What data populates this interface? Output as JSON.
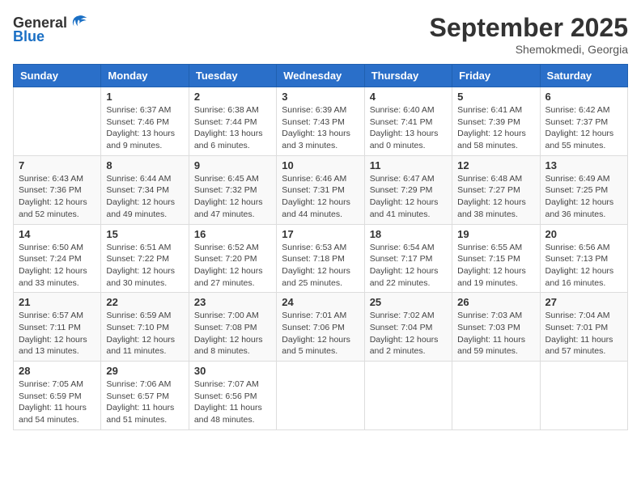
{
  "header": {
    "logo_general": "General",
    "logo_blue": "Blue",
    "month_title": "September 2025",
    "location": "Shemokmedi, Georgia"
  },
  "weekdays": [
    "Sunday",
    "Monday",
    "Tuesday",
    "Wednesday",
    "Thursday",
    "Friday",
    "Saturday"
  ],
  "weeks": [
    [
      {
        "day": "",
        "sunrise": "",
        "sunset": "",
        "daylight": ""
      },
      {
        "day": "1",
        "sunrise": "Sunrise: 6:37 AM",
        "sunset": "Sunset: 7:46 PM",
        "daylight": "Daylight: 13 hours and 9 minutes."
      },
      {
        "day": "2",
        "sunrise": "Sunrise: 6:38 AM",
        "sunset": "Sunset: 7:44 PM",
        "daylight": "Daylight: 13 hours and 6 minutes."
      },
      {
        "day": "3",
        "sunrise": "Sunrise: 6:39 AM",
        "sunset": "Sunset: 7:43 PM",
        "daylight": "Daylight: 13 hours and 3 minutes."
      },
      {
        "day": "4",
        "sunrise": "Sunrise: 6:40 AM",
        "sunset": "Sunset: 7:41 PM",
        "daylight": "Daylight: 13 hours and 0 minutes."
      },
      {
        "day": "5",
        "sunrise": "Sunrise: 6:41 AM",
        "sunset": "Sunset: 7:39 PM",
        "daylight": "Daylight: 12 hours and 58 minutes."
      },
      {
        "day": "6",
        "sunrise": "Sunrise: 6:42 AM",
        "sunset": "Sunset: 7:37 PM",
        "daylight": "Daylight: 12 hours and 55 minutes."
      }
    ],
    [
      {
        "day": "7",
        "sunrise": "Sunrise: 6:43 AM",
        "sunset": "Sunset: 7:36 PM",
        "daylight": "Daylight: 12 hours and 52 minutes."
      },
      {
        "day": "8",
        "sunrise": "Sunrise: 6:44 AM",
        "sunset": "Sunset: 7:34 PM",
        "daylight": "Daylight: 12 hours and 49 minutes."
      },
      {
        "day": "9",
        "sunrise": "Sunrise: 6:45 AM",
        "sunset": "Sunset: 7:32 PM",
        "daylight": "Daylight: 12 hours and 47 minutes."
      },
      {
        "day": "10",
        "sunrise": "Sunrise: 6:46 AM",
        "sunset": "Sunset: 7:31 PM",
        "daylight": "Daylight: 12 hours and 44 minutes."
      },
      {
        "day": "11",
        "sunrise": "Sunrise: 6:47 AM",
        "sunset": "Sunset: 7:29 PM",
        "daylight": "Daylight: 12 hours and 41 minutes."
      },
      {
        "day": "12",
        "sunrise": "Sunrise: 6:48 AM",
        "sunset": "Sunset: 7:27 PM",
        "daylight": "Daylight: 12 hours and 38 minutes."
      },
      {
        "day": "13",
        "sunrise": "Sunrise: 6:49 AM",
        "sunset": "Sunset: 7:25 PM",
        "daylight": "Daylight: 12 hours and 36 minutes."
      }
    ],
    [
      {
        "day": "14",
        "sunrise": "Sunrise: 6:50 AM",
        "sunset": "Sunset: 7:24 PM",
        "daylight": "Daylight: 12 hours and 33 minutes."
      },
      {
        "day": "15",
        "sunrise": "Sunrise: 6:51 AM",
        "sunset": "Sunset: 7:22 PM",
        "daylight": "Daylight: 12 hours and 30 minutes."
      },
      {
        "day": "16",
        "sunrise": "Sunrise: 6:52 AM",
        "sunset": "Sunset: 7:20 PM",
        "daylight": "Daylight: 12 hours and 27 minutes."
      },
      {
        "day": "17",
        "sunrise": "Sunrise: 6:53 AM",
        "sunset": "Sunset: 7:18 PM",
        "daylight": "Daylight: 12 hours and 25 minutes."
      },
      {
        "day": "18",
        "sunrise": "Sunrise: 6:54 AM",
        "sunset": "Sunset: 7:17 PM",
        "daylight": "Daylight: 12 hours and 22 minutes."
      },
      {
        "day": "19",
        "sunrise": "Sunrise: 6:55 AM",
        "sunset": "Sunset: 7:15 PM",
        "daylight": "Daylight: 12 hours and 19 minutes."
      },
      {
        "day": "20",
        "sunrise": "Sunrise: 6:56 AM",
        "sunset": "Sunset: 7:13 PM",
        "daylight": "Daylight: 12 hours and 16 minutes."
      }
    ],
    [
      {
        "day": "21",
        "sunrise": "Sunrise: 6:57 AM",
        "sunset": "Sunset: 7:11 PM",
        "daylight": "Daylight: 12 hours and 13 minutes."
      },
      {
        "day": "22",
        "sunrise": "Sunrise: 6:59 AM",
        "sunset": "Sunset: 7:10 PM",
        "daylight": "Daylight: 12 hours and 11 minutes."
      },
      {
        "day": "23",
        "sunrise": "Sunrise: 7:00 AM",
        "sunset": "Sunset: 7:08 PM",
        "daylight": "Daylight: 12 hours and 8 minutes."
      },
      {
        "day": "24",
        "sunrise": "Sunrise: 7:01 AM",
        "sunset": "Sunset: 7:06 PM",
        "daylight": "Daylight: 12 hours and 5 minutes."
      },
      {
        "day": "25",
        "sunrise": "Sunrise: 7:02 AM",
        "sunset": "Sunset: 7:04 PM",
        "daylight": "Daylight: 12 hours and 2 minutes."
      },
      {
        "day": "26",
        "sunrise": "Sunrise: 7:03 AM",
        "sunset": "Sunset: 7:03 PM",
        "daylight": "Daylight: 11 hours and 59 minutes."
      },
      {
        "day": "27",
        "sunrise": "Sunrise: 7:04 AM",
        "sunset": "Sunset: 7:01 PM",
        "daylight": "Daylight: 11 hours and 57 minutes."
      }
    ],
    [
      {
        "day": "28",
        "sunrise": "Sunrise: 7:05 AM",
        "sunset": "Sunset: 6:59 PM",
        "daylight": "Daylight: 11 hours and 54 minutes."
      },
      {
        "day": "29",
        "sunrise": "Sunrise: 7:06 AM",
        "sunset": "Sunset: 6:57 PM",
        "daylight": "Daylight: 11 hours and 51 minutes."
      },
      {
        "day": "30",
        "sunrise": "Sunrise: 7:07 AM",
        "sunset": "Sunset: 6:56 PM",
        "daylight": "Daylight: 11 hours and 48 minutes."
      },
      {
        "day": "",
        "sunrise": "",
        "sunset": "",
        "daylight": ""
      },
      {
        "day": "",
        "sunrise": "",
        "sunset": "",
        "daylight": ""
      },
      {
        "day": "",
        "sunrise": "",
        "sunset": "",
        "daylight": ""
      },
      {
        "day": "",
        "sunrise": "",
        "sunset": "",
        "daylight": ""
      }
    ]
  ]
}
